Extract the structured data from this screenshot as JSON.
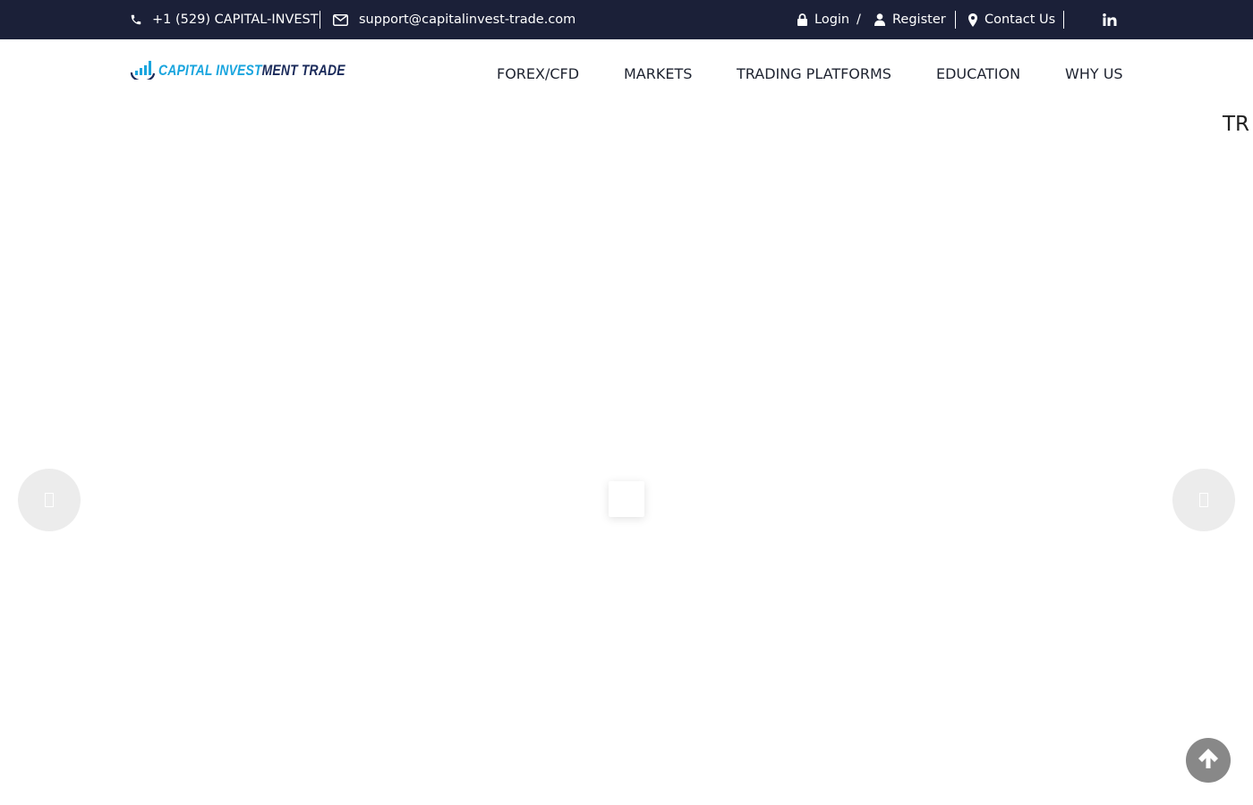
{
  "topbar": {
    "phone": "+1 (529) CAPITAL-INVEST",
    "email": "support@capitalinvest-trade.com",
    "login_label": "Login",
    "slash": "/",
    "register_label": "Register",
    "contact_label": "Contact Us",
    "social_icon": "linkedin-icon"
  },
  "logo": {
    "part_a": "CAPITAL INVEST",
    "part_b": "MENT TRADE"
  },
  "nav": {
    "items": [
      {
        "label": "FOREX/CFD"
      },
      {
        "label": "MARKETS"
      },
      {
        "label": "TRADING PLATFORMS"
      },
      {
        "label": "EDUCATION"
      },
      {
        "label": "WHY US"
      }
    ]
  },
  "hero": {
    "edge_text": "TR"
  },
  "colors": {
    "topbar_bg": "#1b2038",
    "logo_primary": "#1aa5de",
    "logo_secondary": "#1a2a5a",
    "slider_arrow_bg": "#ececec",
    "scroll_top_bg": "#888888"
  },
  "icons": {
    "phone": "phone-icon",
    "email": "envelope-icon",
    "login": "lock-icon",
    "register": "user-icon",
    "contact": "map-marker-icon",
    "prev": "chevron-left-icon",
    "next": "chevron-right-icon",
    "scroll_top": "arrow-up-circle-icon"
  }
}
